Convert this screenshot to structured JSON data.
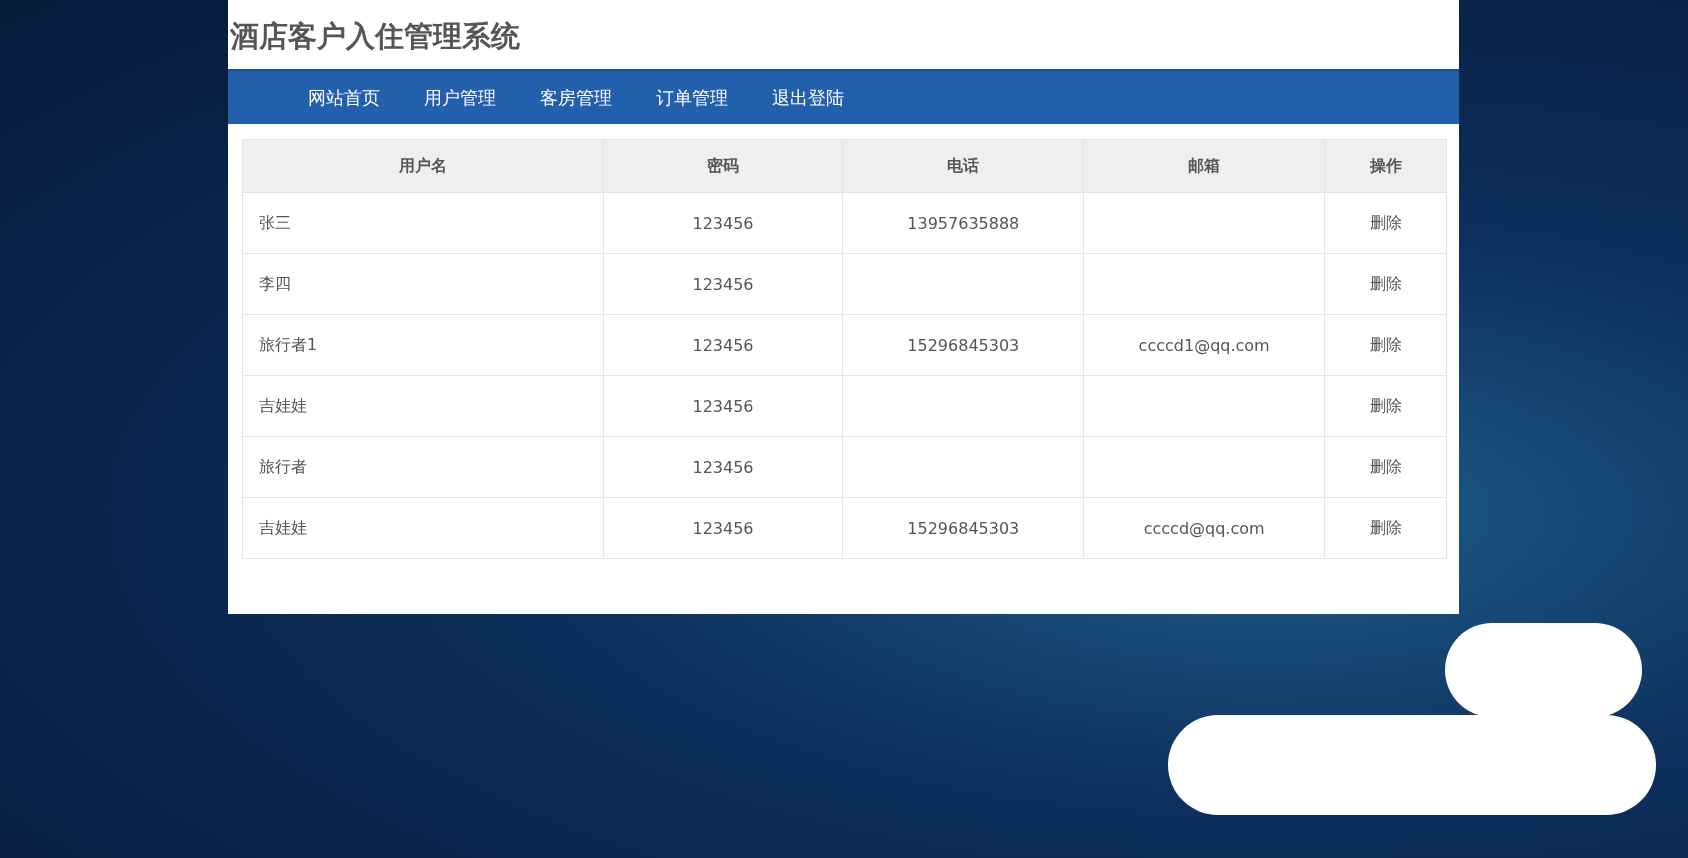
{
  "header": {
    "title": "酒店客户入住管理系统"
  },
  "nav": {
    "items": [
      "网站首页",
      "用户管理",
      "客房管理",
      "订单管理",
      "退出登陆"
    ]
  },
  "table": {
    "columns": [
      "用户名",
      "密码",
      "电话",
      "邮箱",
      "操作"
    ],
    "rows": [
      {
        "username": "张三",
        "password": "123456",
        "phone": "13957635888",
        "action": "删除"
      },
      {
        "username": "李四",
        "password": "123456",
        "action": "删除"
      },
      {
        "username": "旅行者1",
        "password": "123456",
        "phone": "15296845303",
        "email": "ccccd1@qq.com",
        "action": "删除"
      },
      {
        "username": "吉娃娃",
        "password": "123456",
        "action": "删除"
      },
      {
        "username": "旅行者",
        "password": "123456",
        "action": "删除"
      },
      {
        "username": "吉娃娃",
        "password": "123456",
        "phone": "15296845303",
        "email": "ccccd@qq.com",
        "action": "删除"
      }
    ]
  }
}
